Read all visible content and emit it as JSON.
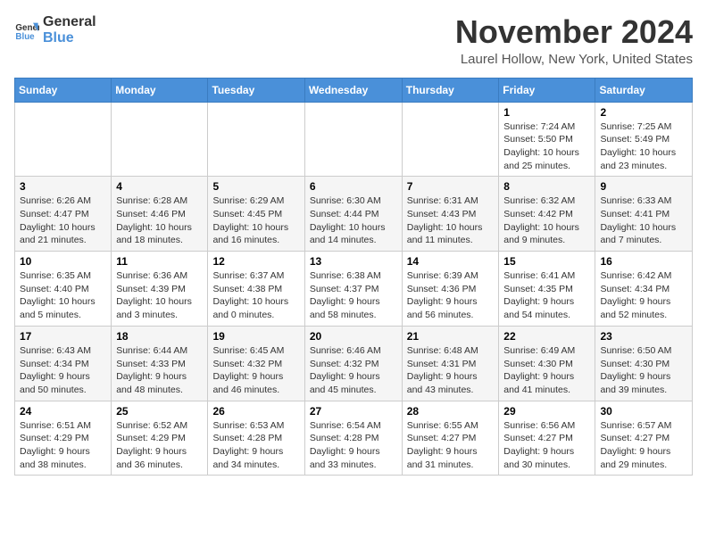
{
  "logo": {
    "general": "General",
    "blue": "Blue"
  },
  "title": "November 2024",
  "location": "Laurel Hollow, New York, United States",
  "headers": [
    "Sunday",
    "Monday",
    "Tuesday",
    "Wednesday",
    "Thursday",
    "Friday",
    "Saturday"
  ],
  "weeks": [
    [
      {
        "day": "",
        "info": ""
      },
      {
        "day": "",
        "info": ""
      },
      {
        "day": "",
        "info": ""
      },
      {
        "day": "",
        "info": ""
      },
      {
        "day": "",
        "info": ""
      },
      {
        "day": "1",
        "info": "Sunrise: 7:24 AM\nSunset: 5:50 PM\nDaylight: 10 hours and 25 minutes."
      },
      {
        "day": "2",
        "info": "Sunrise: 7:25 AM\nSunset: 5:49 PM\nDaylight: 10 hours and 23 minutes."
      }
    ],
    [
      {
        "day": "3",
        "info": "Sunrise: 6:26 AM\nSunset: 4:47 PM\nDaylight: 10 hours and 21 minutes."
      },
      {
        "day": "4",
        "info": "Sunrise: 6:28 AM\nSunset: 4:46 PM\nDaylight: 10 hours and 18 minutes."
      },
      {
        "day": "5",
        "info": "Sunrise: 6:29 AM\nSunset: 4:45 PM\nDaylight: 10 hours and 16 minutes."
      },
      {
        "day": "6",
        "info": "Sunrise: 6:30 AM\nSunset: 4:44 PM\nDaylight: 10 hours and 14 minutes."
      },
      {
        "day": "7",
        "info": "Sunrise: 6:31 AM\nSunset: 4:43 PM\nDaylight: 10 hours and 11 minutes."
      },
      {
        "day": "8",
        "info": "Sunrise: 6:32 AM\nSunset: 4:42 PM\nDaylight: 10 hours and 9 minutes."
      },
      {
        "day": "9",
        "info": "Sunrise: 6:33 AM\nSunset: 4:41 PM\nDaylight: 10 hours and 7 minutes."
      }
    ],
    [
      {
        "day": "10",
        "info": "Sunrise: 6:35 AM\nSunset: 4:40 PM\nDaylight: 10 hours and 5 minutes."
      },
      {
        "day": "11",
        "info": "Sunrise: 6:36 AM\nSunset: 4:39 PM\nDaylight: 10 hours and 3 minutes."
      },
      {
        "day": "12",
        "info": "Sunrise: 6:37 AM\nSunset: 4:38 PM\nDaylight: 10 hours and 0 minutes."
      },
      {
        "day": "13",
        "info": "Sunrise: 6:38 AM\nSunset: 4:37 PM\nDaylight: 9 hours and 58 minutes."
      },
      {
        "day": "14",
        "info": "Sunrise: 6:39 AM\nSunset: 4:36 PM\nDaylight: 9 hours and 56 minutes."
      },
      {
        "day": "15",
        "info": "Sunrise: 6:41 AM\nSunset: 4:35 PM\nDaylight: 9 hours and 54 minutes."
      },
      {
        "day": "16",
        "info": "Sunrise: 6:42 AM\nSunset: 4:34 PM\nDaylight: 9 hours and 52 minutes."
      }
    ],
    [
      {
        "day": "17",
        "info": "Sunrise: 6:43 AM\nSunset: 4:34 PM\nDaylight: 9 hours and 50 minutes."
      },
      {
        "day": "18",
        "info": "Sunrise: 6:44 AM\nSunset: 4:33 PM\nDaylight: 9 hours and 48 minutes."
      },
      {
        "day": "19",
        "info": "Sunrise: 6:45 AM\nSunset: 4:32 PM\nDaylight: 9 hours and 46 minutes."
      },
      {
        "day": "20",
        "info": "Sunrise: 6:46 AM\nSunset: 4:32 PM\nDaylight: 9 hours and 45 minutes."
      },
      {
        "day": "21",
        "info": "Sunrise: 6:48 AM\nSunset: 4:31 PM\nDaylight: 9 hours and 43 minutes."
      },
      {
        "day": "22",
        "info": "Sunrise: 6:49 AM\nSunset: 4:30 PM\nDaylight: 9 hours and 41 minutes."
      },
      {
        "day": "23",
        "info": "Sunrise: 6:50 AM\nSunset: 4:30 PM\nDaylight: 9 hours and 39 minutes."
      }
    ],
    [
      {
        "day": "24",
        "info": "Sunrise: 6:51 AM\nSunset: 4:29 PM\nDaylight: 9 hours and 38 minutes."
      },
      {
        "day": "25",
        "info": "Sunrise: 6:52 AM\nSunset: 4:29 PM\nDaylight: 9 hours and 36 minutes."
      },
      {
        "day": "26",
        "info": "Sunrise: 6:53 AM\nSunset: 4:28 PM\nDaylight: 9 hours and 34 minutes."
      },
      {
        "day": "27",
        "info": "Sunrise: 6:54 AM\nSunset: 4:28 PM\nDaylight: 9 hours and 33 minutes."
      },
      {
        "day": "28",
        "info": "Sunrise: 6:55 AM\nSunset: 4:27 PM\nDaylight: 9 hours and 31 minutes."
      },
      {
        "day": "29",
        "info": "Sunrise: 6:56 AM\nSunset: 4:27 PM\nDaylight: 9 hours and 30 minutes."
      },
      {
        "day": "30",
        "info": "Sunrise: 6:57 AM\nSunset: 4:27 PM\nDaylight: 9 hours and 29 minutes."
      }
    ]
  ]
}
